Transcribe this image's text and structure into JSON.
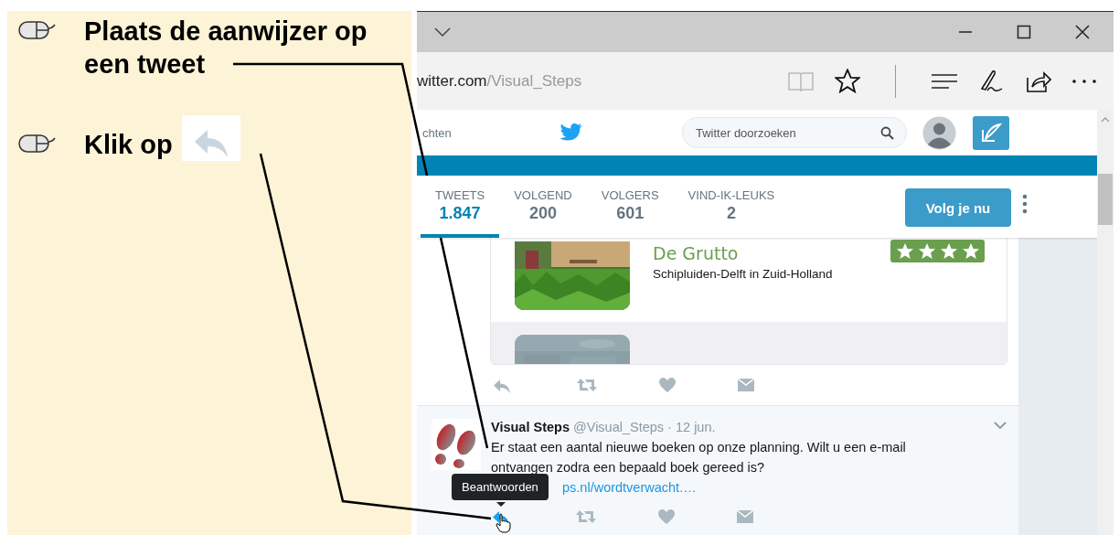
{
  "guide": {
    "steps": [
      {
        "kind": "text",
        "text": "Plaats de aanwijzer op een tweet"
      },
      {
        "kind": "text-with-icon",
        "text": "Klik op"
      }
    ]
  },
  "browser": {
    "address": {
      "host": "witter.com",
      "path": "/Visual_Steps"
    },
    "twitter": {
      "nav_partial": "chten",
      "search": {
        "placeholder": "Twitter doorzoeken"
      },
      "stats": [
        {
          "label": "TWEETS",
          "value": "1.847",
          "selected": true
        },
        {
          "label": "VOLGEND",
          "value": "200",
          "selected": false
        },
        {
          "label": "VOLGERS",
          "value": "601",
          "selected": false
        },
        {
          "label": "VIND-IK-LEUKS",
          "value": "2",
          "selected": false
        }
      ],
      "follow_button": "Volg je nu",
      "card": {
        "title": "De Grutto",
        "subtitle": "Schipluiden-Delft in Zuid-Holland",
        "stars": 4
      },
      "tweet": {
        "name": "Visual Steps",
        "meta": "@Visual_Steps · 12 jun.",
        "text": "Er staat een aantal nieuwe boeken op onze planning. Wilt u een e-mail ontvangen zodra een bepaald boek gereed is?",
        "link": "ps.nl/wordtverwacht.…",
        "reply_hovered": true
      },
      "tooltip": "Beantwoorden"
    }
  }
}
